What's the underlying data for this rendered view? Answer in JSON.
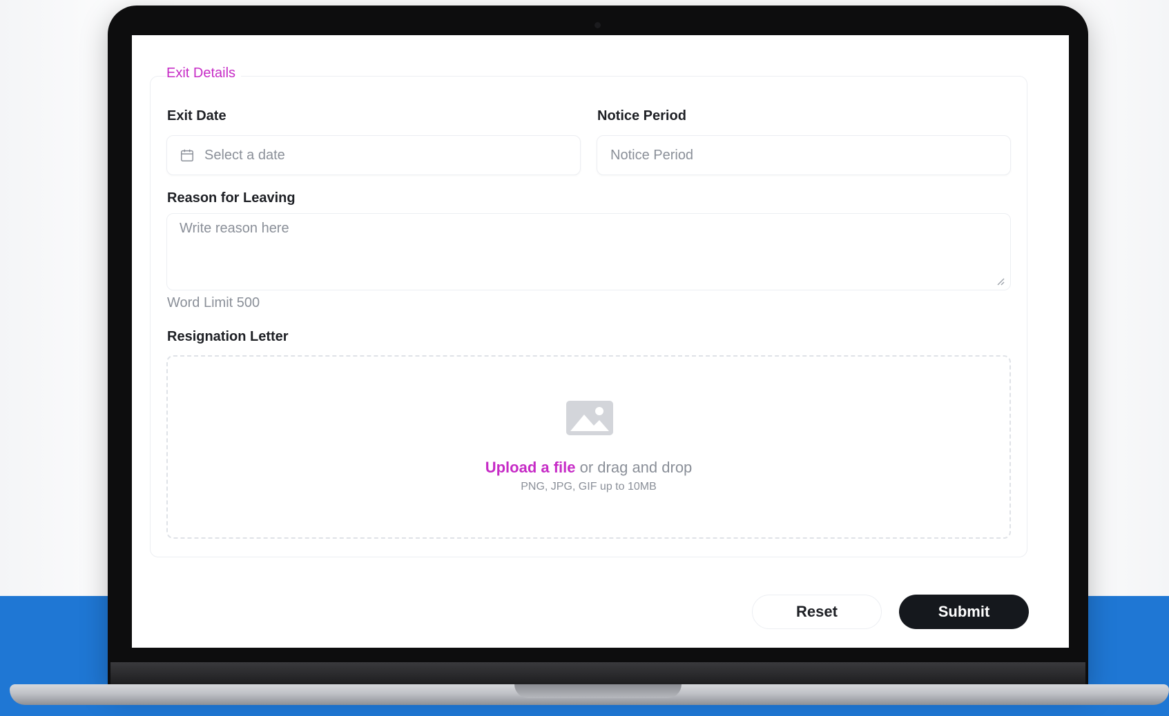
{
  "form": {
    "section_title": "Exit Details",
    "exit_date": {
      "label": "Exit Date",
      "placeholder": "Select a date"
    },
    "notice_period": {
      "label": "Notice Period",
      "placeholder": "Notice Period"
    },
    "reason": {
      "label": "Reason for Leaving",
      "placeholder": "Write reason here",
      "hint": "Word Limit 500"
    },
    "resignation_letter": {
      "label": "Resignation Letter",
      "upload_link": "Upload a file",
      "upload_text": "or drag and drop",
      "upload_hint": "PNG, JPG, GIF up to 10MB"
    },
    "actions": {
      "reset_label": "Reset",
      "submit_label": "Submit"
    }
  },
  "colors": {
    "accent": "#c62bc6",
    "submit_bg": "#15181d",
    "band": "#1f77d4"
  }
}
